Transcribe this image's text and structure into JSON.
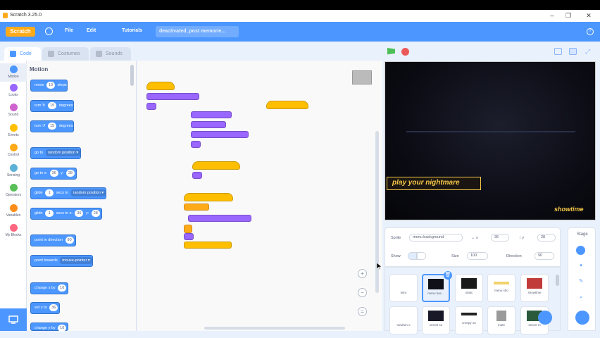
{
  "window": {
    "title": "Scratch 3.25.0",
    "controls": [
      "–",
      "❐",
      "✕"
    ]
  },
  "menubar": {
    "logo": "Scratch",
    "items": [
      "File",
      "Edit",
      "Tutorials"
    ],
    "project_title": "deactivated_post memorie..."
  },
  "tabs": [
    {
      "label": "Code"
    },
    {
      "label": "Costumes"
    },
    {
      "label": "Sounds"
    }
  ],
  "categories": [
    {
      "label": "Motion",
      "color": "#4c97ff"
    },
    {
      "label": "Looks",
      "color": "#9966ff"
    },
    {
      "label": "Sound",
      "color": "#cf63cf"
    },
    {
      "label": "Events",
      "color": "#ffbf00"
    },
    {
      "label": "Control",
      "color": "#ffab19"
    },
    {
      "label": "Sensing",
      "color": "#5cb1d6"
    },
    {
      "label": "Operators",
      "color": "#59c059"
    },
    {
      "label": "Variables",
      "color": "#ff8c1a"
    },
    {
      "label": "My Blocks",
      "color": "#ff6680"
    }
  ],
  "palette": {
    "title": "Motion",
    "blocks": [
      {
        "pre": "move",
        "num": "10",
        "post": "steps"
      },
      {
        "pre": "turn ↻",
        "num": "15",
        "post": "degrees"
      },
      {
        "pre": "turn ↺",
        "num": "15",
        "post": "degrees"
      },
      {
        "pre": "go to",
        "dd": "random position ▾"
      },
      {
        "pre": "go to x:",
        "num": "36",
        "mid": "y:",
        "num2": "28"
      },
      {
        "pre": "glide",
        "num": "1",
        "mid": "secs to",
        "dd": "random position ▾"
      },
      {
        "pre": "glide",
        "num": "1",
        "mid": "secs to x:",
        "num2": "36",
        "mid2": "y:",
        "num3": "28"
      },
      {
        "pre": "point in direction",
        "num": "90"
      },
      {
        "pre": "point towards",
        "dd": "mouse-pointer ▾"
      },
      {
        "pre": "change x by",
        "num": "10"
      },
      {
        "pre": "set x to",
        "num": "36"
      },
      {
        "pre": "change y by",
        "num": "10"
      }
    ]
  },
  "stage": {
    "text_nightmare": "play your nightmare",
    "text_showtime": "showtime"
  },
  "sprite_info": {
    "sprite_label": "Sprite",
    "sprite_name": "menu background",
    "x_label": "↔  x",
    "x_value": "36",
    "y_label": "↕  y",
    "y_value": "28",
    "show_label": "Show",
    "size_label": "Size",
    "size_value": "100",
    "direction_label": "Direction",
    "direction_value": "90"
  },
  "sprites": [
    {
      "name": "intro",
      "color": "#ffffff"
    },
    {
      "name": "menu bac...",
      "color": "#101018",
      "selected": true
    },
    {
      "name": "static",
      "color": "#1a1a1a"
    },
    {
      "name": "menu sho",
      "color": "#f2d26b"
    },
    {
      "name": "showtime",
      "color": "#c23b3b"
    },
    {
      "name": "random o",
      "color": "#ffffff"
    },
    {
      "name": "secret so",
      "color": "#181828"
    },
    {
      "name": "creepy on",
      "color": "#222222"
    },
    {
      "name": "mute",
      "color": "#9a9a9a"
    },
    {
      "name": "secret m",
      "color": "#2a5a3a"
    }
  ],
  "stage_panel": {
    "label": "Stage"
  }
}
